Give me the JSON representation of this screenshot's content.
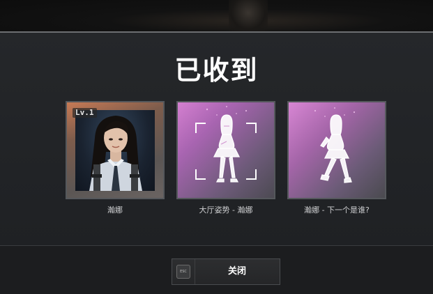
{
  "header": {
    "title": "已收到"
  },
  "rewards": [
    {
      "caption": "瀚娜",
      "level_badge": "Lv.1",
      "icon": "character-portrait"
    },
    {
      "caption": "大厅姿势 - 瀚娜",
      "icon": "pose-figure-with-frame"
    },
    {
      "caption": "瀚娜 - 下一个是谁?",
      "icon": "emote-figure"
    }
  ],
  "footer": {
    "close_label": "关闭",
    "esc_hint": "ESC"
  },
  "colors": {
    "accent_pink": "#c877c8",
    "portrait_bg": "#1a2330",
    "panel": "#25272a"
  }
}
